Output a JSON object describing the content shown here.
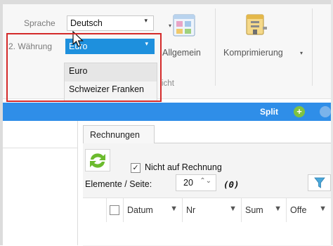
{
  "ribbon": {
    "language_label": "Sprache",
    "language_value": "Deutsch",
    "currency2_label": "2. Währung",
    "currency2_value": "Euro",
    "currency2_options": [
      "Euro",
      "Schweizer Franken"
    ],
    "general_button": "Allgemein",
    "compression_button": "Komprimierung",
    "group_label_fragment": "icht"
  },
  "toolbar": {
    "split_label": "Split"
  },
  "tabs": [
    {
      "label": "Rechnungen"
    }
  ],
  "filters": {
    "not_on_invoice_label": "Nicht auf Rechnung",
    "not_on_invoice_checked": true,
    "checkmark": "✓"
  },
  "pager": {
    "items_per_page_label": "Elemente / Seite:",
    "items_per_page": "20",
    "count": "(0)"
  },
  "grid": {
    "columns": [
      "Datum",
      "Nr",
      "Sum",
      "Offe"
    ]
  },
  "colors": {
    "accent_blue": "#2f8ee8",
    "dropdown_highlight": "#1e90dd",
    "callout_red": "#d42a2a",
    "add_green": "#7fc241"
  },
  "icons": {
    "dropdown_arrow": "▾",
    "spin": "⌃⌄",
    "column_filter": "▼"
  }
}
